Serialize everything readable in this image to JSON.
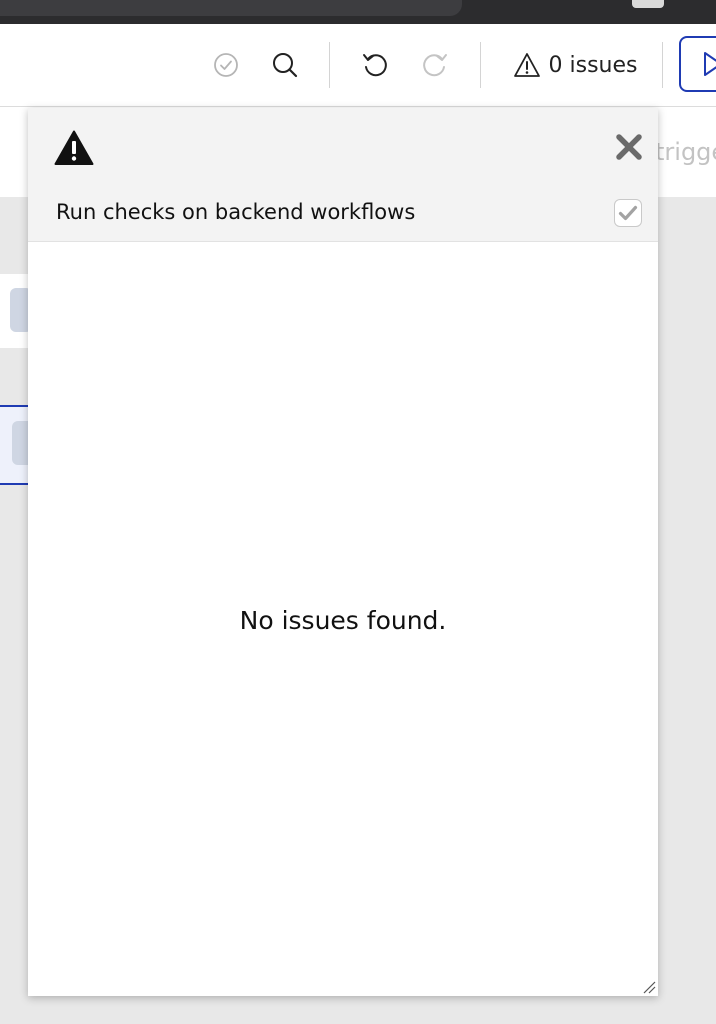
{
  "toolbar": {
    "check_icon": "check-circle-icon",
    "search_icon": "search-icon",
    "undo_icon": "undo-icon",
    "redo_icon": "redo-icon",
    "issues_icon": "warning-icon",
    "issues_label": "0 issues",
    "run_icon": "play-icon"
  },
  "background": {
    "trigger_text": "trigge"
  },
  "panel": {
    "header_icon": "warning-icon",
    "close_icon": "close-icon",
    "backend_checks_label": "Run checks on backend workflows",
    "backend_checks_checked": true,
    "empty_message": "No issues found."
  },
  "colors": {
    "accent": "#1f3bb3",
    "panel_header_bg": "#f3f3f3",
    "canvas_bg": "#e8e8e8"
  }
}
